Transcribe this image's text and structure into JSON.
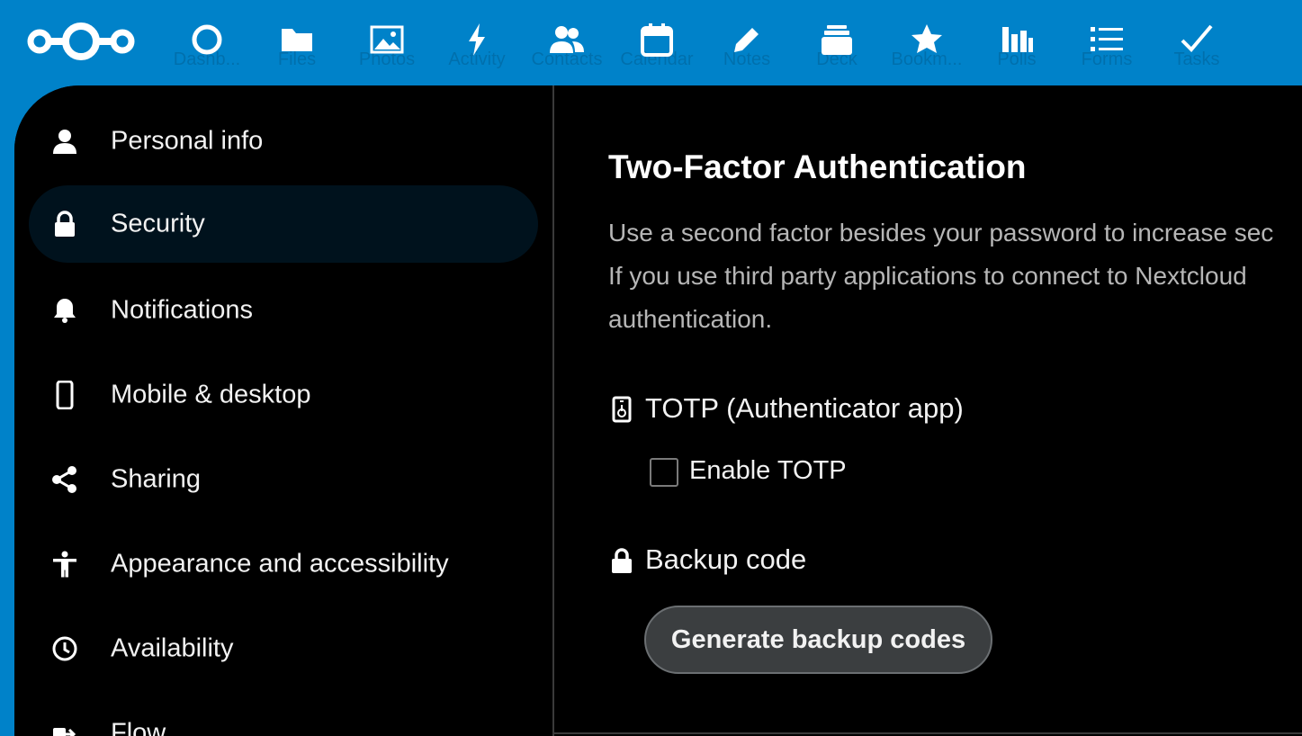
{
  "header": {
    "logo_icon": "nextcloud-logo-icon",
    "apps": [
      {
        "label": "Dashb...",
        "icon": "dashboard-icon"
      },
      {
        "label": "Files",
        "icon": "folder-icon"
      },
      {
        "label": "Photos",
        "icon": "image-icon"
      },
      {
        "label": "Activity",
        "icon": "lightning-icon"
      },
      {
        "label": "Contacts",
        "icon": "contacts-icon"
      },
      {
        "label": "Calendar",
        "icon": "calendar-icon"
      },
      {
        "label": "Notes",
        "icon": "pencil-icon"
      },
      {
        "label": "Deck",
        "icon": "deck-icon"
      },
      {
        "label": "Bookm...",
        "icon": "star-icon"
      },
      {
        "label": "Polls",
        "icon": "bar-chart-icon"
      },
      {
        "label": "Forms",
        "icon": "list-icon"
      },
      {
        "label": "Tasks",
        "icon": "checkmark-icon"
      }
    ]
  },
  "sidebar": {
    "items": [
      {
        "label": "Personal info",
        "icon": "user-icon"
      },
      {
        "label": "Security",
        "icon": "lock-icon",
        "active": true
      },
      {
        "label": "Notifications",
        "icon": "bell-icon"
      },
      {
        "label": "Mobile & desktop",
        "icon": "phone-icon"
      },
      {
        "label": "Sharing",
        "icon": "share-icon"
      },
      {
        "label": "Appearance and accessibility",
        "icon": "accessibility-icon"
      },
      {
        "label": "Availability",
        "icon": "clock-icon"
      },
      {
        "label": "Flow",
        "icon": "flow-icon"
      }
    ]
  },
  "main": {
    "title": "Two-Factor Authentication",
    "description_lines": [
      "Use a second factor besides your password to increase sec",
      "If you use third party applications to connect to Nextcloud",
      "authentication."
    ],
    "totp": {
      "label": "TOTP (Authenticator app)",
      "icon": "authenticator-icon",
      "checkbox_label": "Enable TOTP",
      "checked": false
    },
    "backup": {
      "label": "Backup code",
      "icon": "lock-icon",
      "button_label": "Generate backup codes"
    }
  },
  "colors": {
    "header_bg": "#0082c9",
    "content_bg": "#000000",
    "active_nav_bg": "#00121d",
    "button_bg": "#3b3e40",
    "text_primary": "#f2f2f2",
    "text_muted": "#b6b6b6"
  }
}
